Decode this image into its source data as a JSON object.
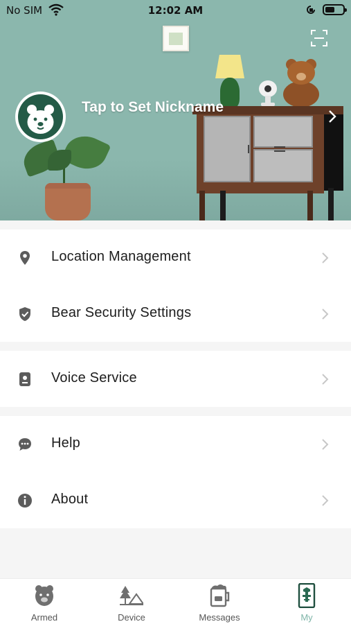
{
  "status_bar": {
    "carrier": "No SIM",
    "time": "12:02 AM",
    "battery_level": 0.55
  },
  "header": {
    "nickname_prompt": "Tap to Set Nickname",
    "background_color": "#8bb7ad"
  },
  "menu_sections": [
    {
      "items": [
        {
          "label": "Location Management",
          "icon": "location-pin-icon"
        },
        {
          "label": "Bear Security Settings",
          "icon": "shield-check-icon"
        }
      ]
    },
    {
      "items": [
        {
          "label": "Voice Service",
          "icon": "speaker-device-icon"
        }
      ]
    },
    {
      "items": [
        {
          "label": "Help",
          "icon": "chat-bubble-icon"
        },
        {
          "label": "About",
          "icon": "info-icon"
        }
      ]
    }
  ],
  "tabbar": {
    "tabs": [
      {
        "label": "Armed",
        "icon": "bear-icon"
      },
      {
        "label": "Device",
        "icon": "camp-icon"
      },
      {
        "label": "Messages",
        "icon": "mug-icon"
      },
      {
        "label": "My",
        "icon": "phone-bear-icon",
        "active": true
      }
    ],
    "active_color": "#7fb5a8"
  }
}
